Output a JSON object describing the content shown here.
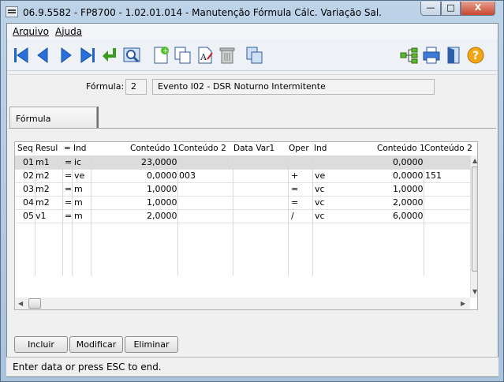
{
  "window": {
    "title": "06.9.5582 - FP8700 - 1.02.01.014 - Manutenção Fórmula Cálc. Variação Sal.",
    "minimize": "—",
    "maximize": "□",
    "close": "X"
  },
  "menu": {
    "arquivo": "Arquivo",
    "ajuda": "Ajuda"
  },
  "toolbar": {
    "icons": [
      "first-record-icon",
      "previous-record-icon",
      "next-record-icon",
      "last-record-icon",
      "return-icon",
      "search-zoom-icon",
      "new-document-icon",
      "copy-icon",
      "edit-text-icon",
      "delete-trash-icon",
      "duplicate-icon",
      "tree-structure-icon",
      "print-icon",
      "exit-door-icon",
      "help-icon"
    ]
  },
  "header": {
    "formula_label": "Fórmula:",
    "formula_code": "2",
    "formula_desc": "Evento I02 - DSR Noturno Intermitente"
  },
  "tab": {
    "label": "Fórmula"
  },
  "grid": {
    "columns": [
      "Seq",
      "Resul",
      "=",
      "Ind",
      "Conteúdo 1",
      "Conteúdo 2",
      "Data Var1",
      "Oper",
      "Ind",
      "Conteúdo 1",
      "Conteúdo 2"
    ],
    "rows": [
      {
        "seq": "01",
        "resul": "m1",
        "eq": "=",
        "ind": "ic",
        "c1": "23,0000",
        "c2": "",
        "dv": "",
        "oper": "",
        "ind2": "",
        "c1b": "0,0000",
        "c2b": ""
      },
      {
        "seq": "02",
        "resul": "m2",
        "eq": "=",
        "ind": "ve",
        "c1": "0,0000",
        "c2": "003",
        "dv": "",
        "oper": "+",
        "ind2": "ve",
        "c1b": "0,0000",
        "c2b": "151"
      },
      {
        "seq": "03",
        "resul": "m2",
        "eq": "=",
        "ind": "m",
        "c1": "1,0000",
        "c2": "",
        "dv": "",
        "oper": "=",
        "ind2": "vc",
        "c1b": "1,0000",
        "c2b": ""
      },
      {
        "seq": "04",
        "resul": "m2",
        "eq": "=",
        "ind": "m",
        "c1": "1,0000",
        "c2": "",
        "dv": "",
        "oper": "=",
        "ind2": "vc",
        "c1b": "2,0000",
        "c2b": ""
      },
      {
        "seq": "05",
        "resul": "v1",
        "eq": "=",
        "ind": "m",
        "c1": "2,0000",
        "c2": "",
        "dv": "",
        "oper": "/",
        "ind2": "vc",
        "c1b": "6,0000",
        "c2b": ""
      }
    ]
  },
  "buttons": {
    "incluir": "Incluir",
    "modificar": "Modificar",
    "eliminar": "Eliminar"
  },
  "status": {
    "text": "Enter data or press ESC to end."
  }
}
